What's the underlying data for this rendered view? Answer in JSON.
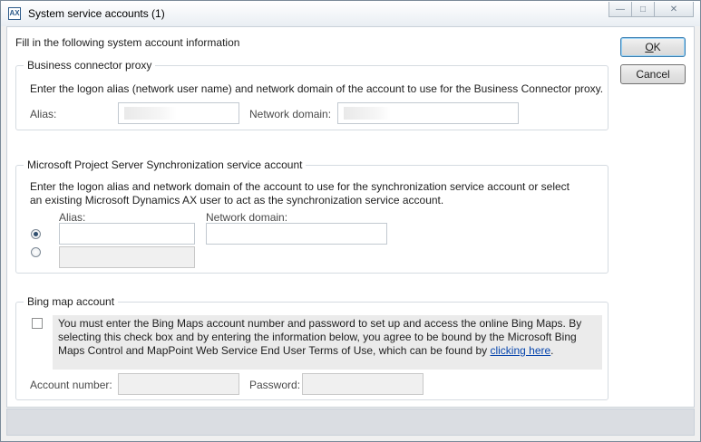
{
  "window": {
    "title": "System service accounts (1)",
    "icon": "dynamics-ax-icon",
    "controls": [
      "minimize-icon",
      "maximize-icon",
      "close-icon"
    ]
  },
  "intro": "Fill in the following system account information",
  "buttons": {
    "ok": "OK",
    "ok_access_key": "O",
    "cancel": "Cancel"
  },
  "bc_proxy": {
    "title": "Business connector proxy",
    "description": "Enter the logon alias (network user name) and network domain of the account to use for the Business Connector proxy.",
    "alias_label": "Alias:",
    "domain_label": "Network domain:"
  },
  "sync": {
    "title": "Microsoft Project Server Synchronization service account",
    "description_line1": "Enter the logon alias and network domain of the account to use for the synchronization service account or select",
    "description_line2": "an existing Microsoft Dynamics AX user to act as the  synchronization service account.",
    "alias_label": "Alias:",
    "domain_label": "Network domain:",
    "selected_option": "alias-and-domain"
  },
  "bing": {
    "title": "Bing map account",
    "notice_line1": "You must enter the Bing Maps account number and password to set up and access the online Bing Maps. By",
    "notice_line2": "selecting this check box and by entering the information below, you agree to be bound by the Microsoft Bing",
    "notice_line3": "Maps Control and MapPoint Web Service End User Terms of Use, which can be found by ",
    "link_text": "clicking here",
    "after_link": ".",
    "account_label": "Account number:",
    "password_label": "Password:",
    "checked": false
  }
}
